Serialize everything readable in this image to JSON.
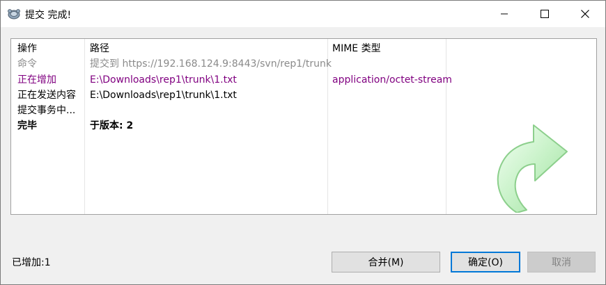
{
  "window": {
    "title": "提交 完成!",
    "icon": "tortoisesvn-icon",
    "controls": [
      "minimize-icon",
      "maximize-icon",
      "close-icon"
    ]
  },
  "table": {
    "headers": [
      "操作",
      "路径",
      "MIME 类型"
    ],
    "rows": [
      {
        "action": "命令",
        "path": "提交到 https://192.168.124.9:8443/svn/rep1/trunk",
        "mime": "",
        "color": "#8a8a8a"
      },
      {
        "action": "正在增加",
        "path": "E:\\Downloads\\rep1\\trunk\\1.txt",
        "mime": "application/octet-stream",
        "color": "#800080"
      },
      {
        "action": "正在发送内容",
        "path": "E:\\Downloads\\rep1\\trunk\\1.txt",
        "mime": "",
        "color": "#000000"
      },
      {
        "action": "提交事务中...",
        "path": "",
        "mime": "",
        "color": "#000000"
      },
      {
        "action": "完毕",
        "path": "于版本: 2",
        "mime": "",
        "color": "#000000",
        "bold": true
      }
    ]
  },
  "status": "已增加:1",
  "buttons": {
    "merge": "合并(M)",
    "ok": "确定(O)",
    "cancel": "取消"
  }
}
